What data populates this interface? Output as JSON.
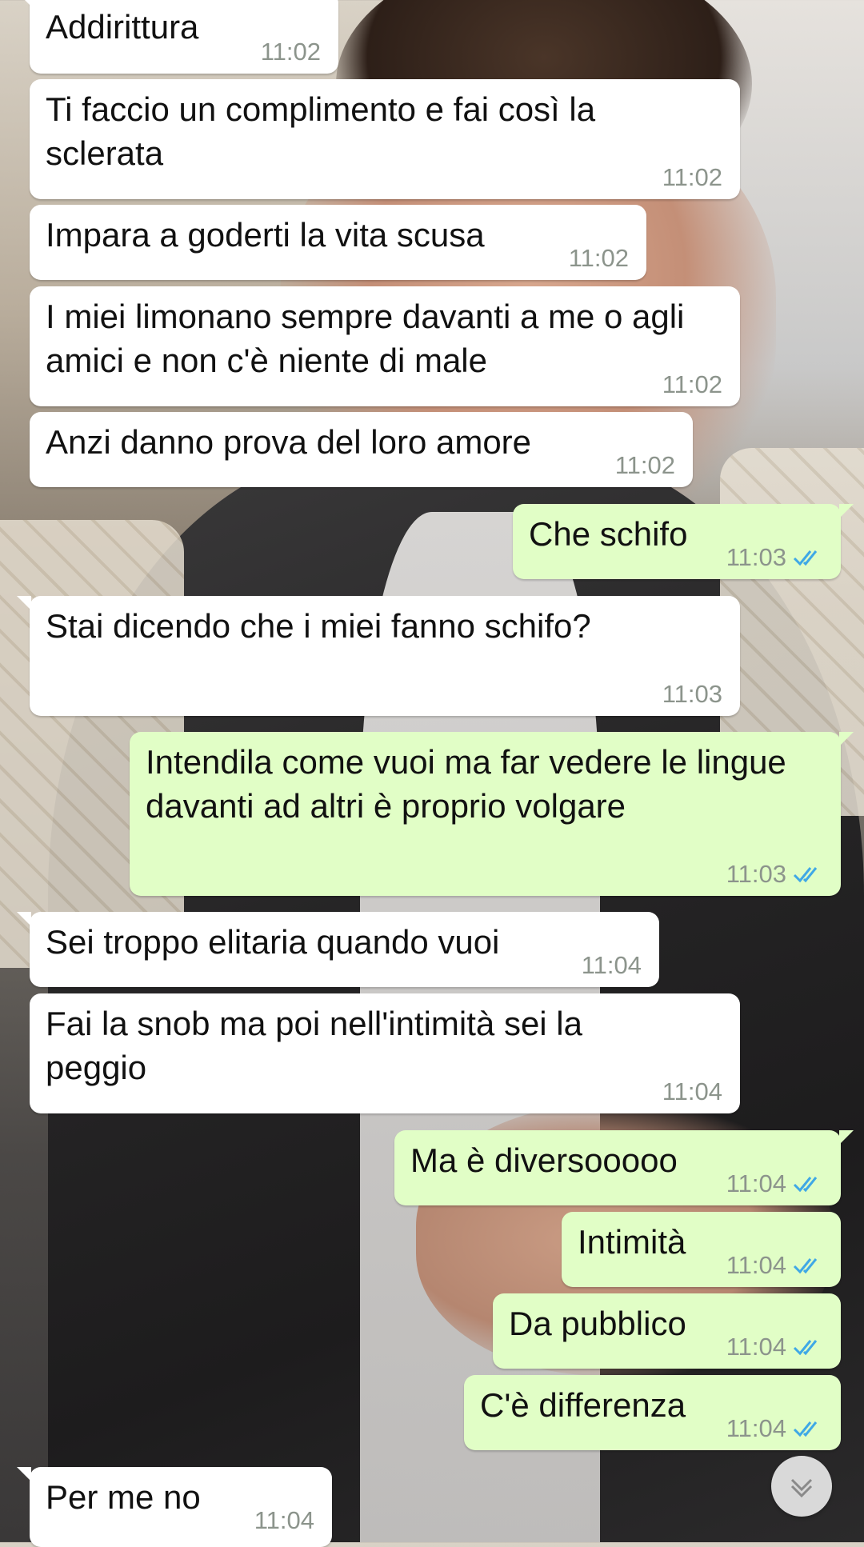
{
  "colors": {
    "incoming_bubble": "#ffffff",
    "outgoing_bubble": "#e1fec6",
    "timestamp": "#8c948c",
    "read_ticks": "#3fa8e6"
  },
  "icons": {
    "read_receipt": "double-check-icon",
    "scroll_down": "chevron-down-icon"
  },
  "messages": [
    {
      "direction": "in",
      "text": "Addirittura",
      "time": "11:02"
    },
    {
      "direction": "in",
      "text": "Ti faccio un complimento e fai così la sclerata",
      "time": "11:02"
    },
    {
      "direction": "in",
      "text": "Impara a goderti la vita scusa",
      "time": "11:02"
    },
    {
      "direction": "in",
      "text": "I miei limonano sempre davanti a me o agli amici e non c'è niente di male",
      "time": "11:02"
    },
    {
      "direction": "in",
      "text": "Anzi danno prova del loro amore",
      "time": "11:02"
    },
    {
      "direction": "out",
      "text": "Che schifo",
      "time": "11:03",
      "read": true
    },
    {
      "direction": "in",
      "text": "Stai dicendo che i miei fanno schifo?",
      "time": "11:03"
    },
    {
      "direction": "out",
      "text": "Intendila come vuoi ma far vedere le lingue davanti ad altri è proprio volgare",
      "time": "11:03",
      "read": true
    },
    {
      "direction": "in",
      "text": "Sei troppo elitaria quando vuoi",
      "time": "11:04"
    },
    {
      "direction": "in",
      "text": "Fai la snob ma poi nell'intimità sei la peggio",
      "time": "11:04"
    },
    {
      "direction": "out",
      "text": "Ma è diversooooo",
      "time": "11:04",
      "read": true
    },
    {
      "direction": "out",
      "text": "Intimità",
      "time": "11:04",
      "read": true
    },
    {
      "direction": "out",
      "text": "Da pubblico",
      "time": "11:04",
      "read": true
    },
    {
      "direction": "out",
      "text": "C'è differenza",
      "time": "11:04",
      "read": true
    },
    {
      "direction": "in",
      "text": "Per me no",
      "time": "11:04"
    }
  ]
}
